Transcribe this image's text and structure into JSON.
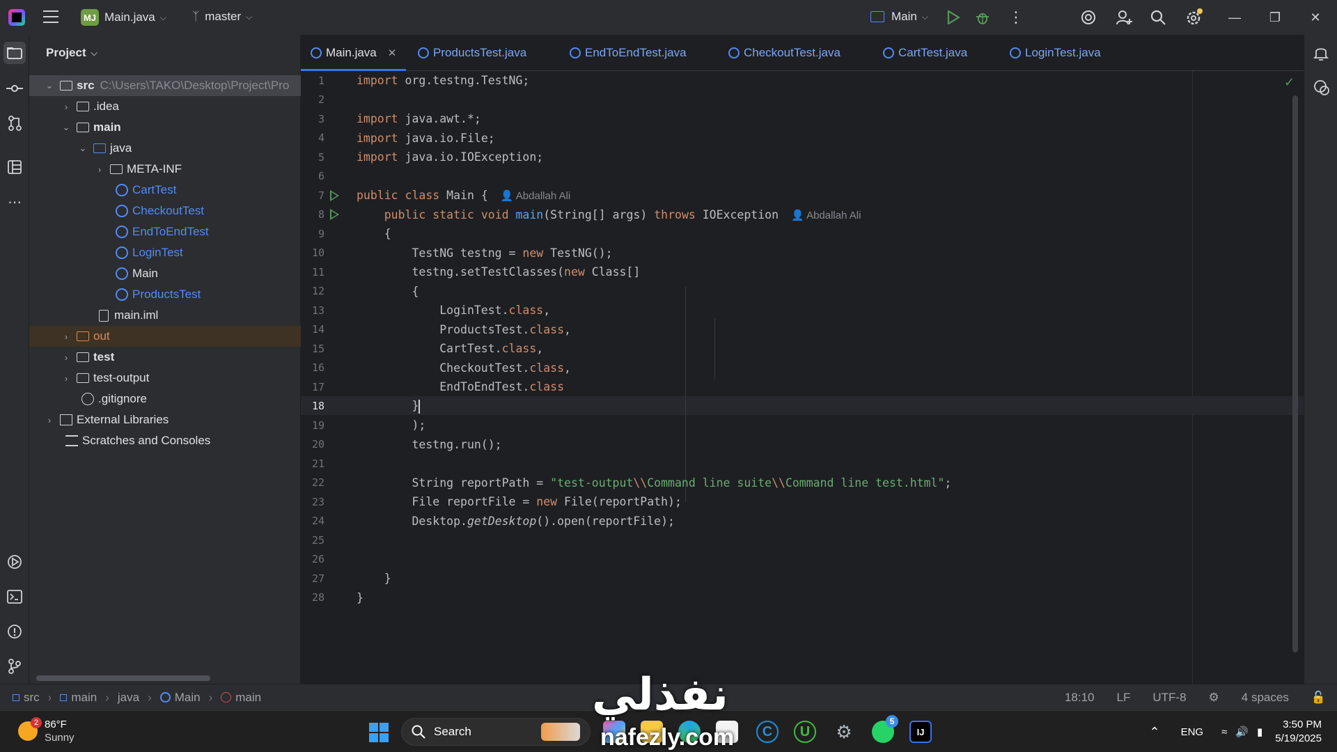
{
  "titlebar": {
    "project_badge": "MJ",
    "project_name": "Main.java",
    "branch": "master",
    "run_config": "Main"
  },
  "project_panel": {
    "header": "Project",
    "tree": [
      {
        "label": "src",
        "extra": "C:\\Users\\TAKO\\Desktop\\Project\\Pro"
      },
      {
        "label": ".idea"
      },
      {
        "label": "main"
      },
      {
        "label": "java"
      },
      {
        "label": "META-INF"
      },
      {
        "label": "CartTest"
      },
      {
        "label": "CheckoutTest"
      },
      {
        "label": "EndToEndTest"
      },
      {
        "label": "LoginTest"
      },
      {
        "label": "Main"
      },
      {
        "label": "ProductsTest"
      },
      {
        "label": "main.iml"
      },
      {
        "label": "out"
      },
      {
        "label": "test"
      },
      {
        "label": "test-output"
      },
      {
        "label": ".gitignore"
      },
      {
        "label": "External Libraries"
      },
      {
        "label": "Scratches and Consoles"
      }
    ]
  },
  "tabs": [
    {
      "label": "Main.java"
    },
    {
      "label": "ProductsTest.java"
    },
    {
      "label": "EndToEndTest.java"
    },
    {
      "label": "CheckoutTest.java"
    },
    {
      "label": "CartTest.java"
    },
    {
      "label": "LoginTest.java"
    }
  ],
  "editor": {
    "author_hint": "Abdallah Ali",
    "line_numbers": [
      "1",
      "2",
      "3",
      "4",
      "5",
      "6",
      "7",
      "8",
      "9",
      "10",
      "11",
      "12",
      "13",
      "14",
      "15",
      "16",
      "17",
      "18",
      "19",
      "20",
      "21",
      "22",
      "23",
      "24",
      "25",
      "26",
      "27",
      "28"
    ],
    "current_line": "18"
  },
  "statusbar": {
    "breadcrumb": [
      "src",
      "main",
      "java",
      "Main",
      "main"
    ],
    "position": "18:10",
    "line_ending": "LF",
    "encoding": "UTF-8",
    "indent": "4 spaces"
  },
  "taskbar": {
    "weather_badge": "2",
    "temperature": "86°F",
    "condition": "Sunny",
    "search_label": "Search",
    "whatsapp_badge": "5",
    "language": "ENG",
    "time": "3:50 PM",
    "date": "5/19/2025"
  },
  "watermark": {
    "arabic": "نفذلي",
    "latin": "nafezly.com"
  },
  "colors": {
    "keyword": "#cf8e6d",
    "string": "#6aab73",
    "function": "#56a8f5",
    "accent": "#3574f0"
  }
}
